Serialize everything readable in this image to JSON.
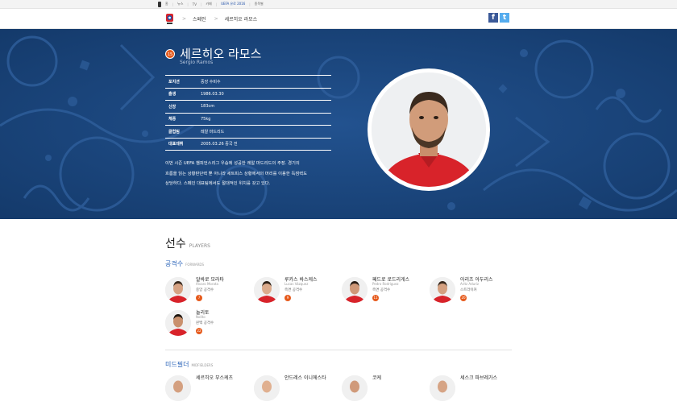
{
  "gnb": {
    "items": [
      {
        "label": "홈"
      },
      {
        "label": "뉴스"
      },
      {
        "label": "TV"
      },
      {
        "label": "카페"
      },
      {
        "label": "UEFA 유로 2016"
      },
      {
        "label": "종목별"
      }
    ],
    "active_index": 4
  },
  "breadcrumb": [
    "스페인",
    "세르히오 라모스"
  ],
  "share": {
    "facebook": "f",
    "twitter": "t"
  },
  "profile": {
    "number": "15",
    "name_ko": "세르히오 라모스",
    "name_en": "Sergio Ramos",
    "info": [
      {
        "key": "포지션",
        "value": "중앙 수비수"
      },
      {
        "key": "출생",
        "value": "1986.03.30"
      },
      {
        "key": "신장",
        "value": "183cm"
      },
      {
        "key": "체중",
        "value": "75kg"
      },
      {
        "key": "클럽팀",
        "value": "레알 마드리드"
      },
      {
        "key": "대표데뷔",
        "value": "2005.03.26 중국 전"
      }
    ],
    "description": [
      "이번 시즌 UEFA 챔피언스리그 우승에 성공한 레알 마드리드의 주장. 경기의",
      "흐름을 읽는 상황판단력 뿐 아니라 세트피스 상황에서의 머리를 이용한 득점력도",
      "상당하다. 스페인 대표팀에서도 절대적인 위치를 갖고 있다."
    ]
  },
  "players_section": {
    "title_ko": "선수",
    "title_en": "PLAYERS",
    "groups": [
      {
        "title_ko": "공격수",
        "title_en": "FORWARDS",
        "players": [
          {
            "name_ko": "알바로 모라타",
            "name_en": "Álvaro Morata",
            "position": "중앙 공격수",
            "number": "7"
          },
          {
            "name_ko": "루카스 바스케스",
            "name_en": "Lucas Vázquez",
            "position": "측면 공격수",
            "number": "9"
          },
          {
            "name_ko": "페드로 로드리게스",
            "name_en": "Pedro Rodríguez",
            "position": "측면 공격수",
            "number": "11"
          },
          {
            "name_ko": "아리츠 아두리스",
            "name_en": "Aritz Aduriz",
            "position": "스트라이커",
            "number": "20"
          },
          {
            "name_ko": "놀리토",
            "name_en": "Nolito",
            "position": "윈백 공격수",
            "number": "22"
          }
        ]
      },
      {
        "title_ko": "미드필더",
        "title_en": "MIDFIELDERS",
        "players": [
          {
            "name_ko": "세르히오 부스케츠"
          },
          {
            "name_ko": "안드레스 이니에스타"
          },
          {
            "name_ko": "코케"
          },
          {
            "name_ko": "세스크 파브레가스"
          }
        ]
      }
    ]
  },
  "colors": {
    "hero_bg": "#1b467d",
    "badge": "#e65a1c",
    "group_title": "#2a63b8"
  }
}
